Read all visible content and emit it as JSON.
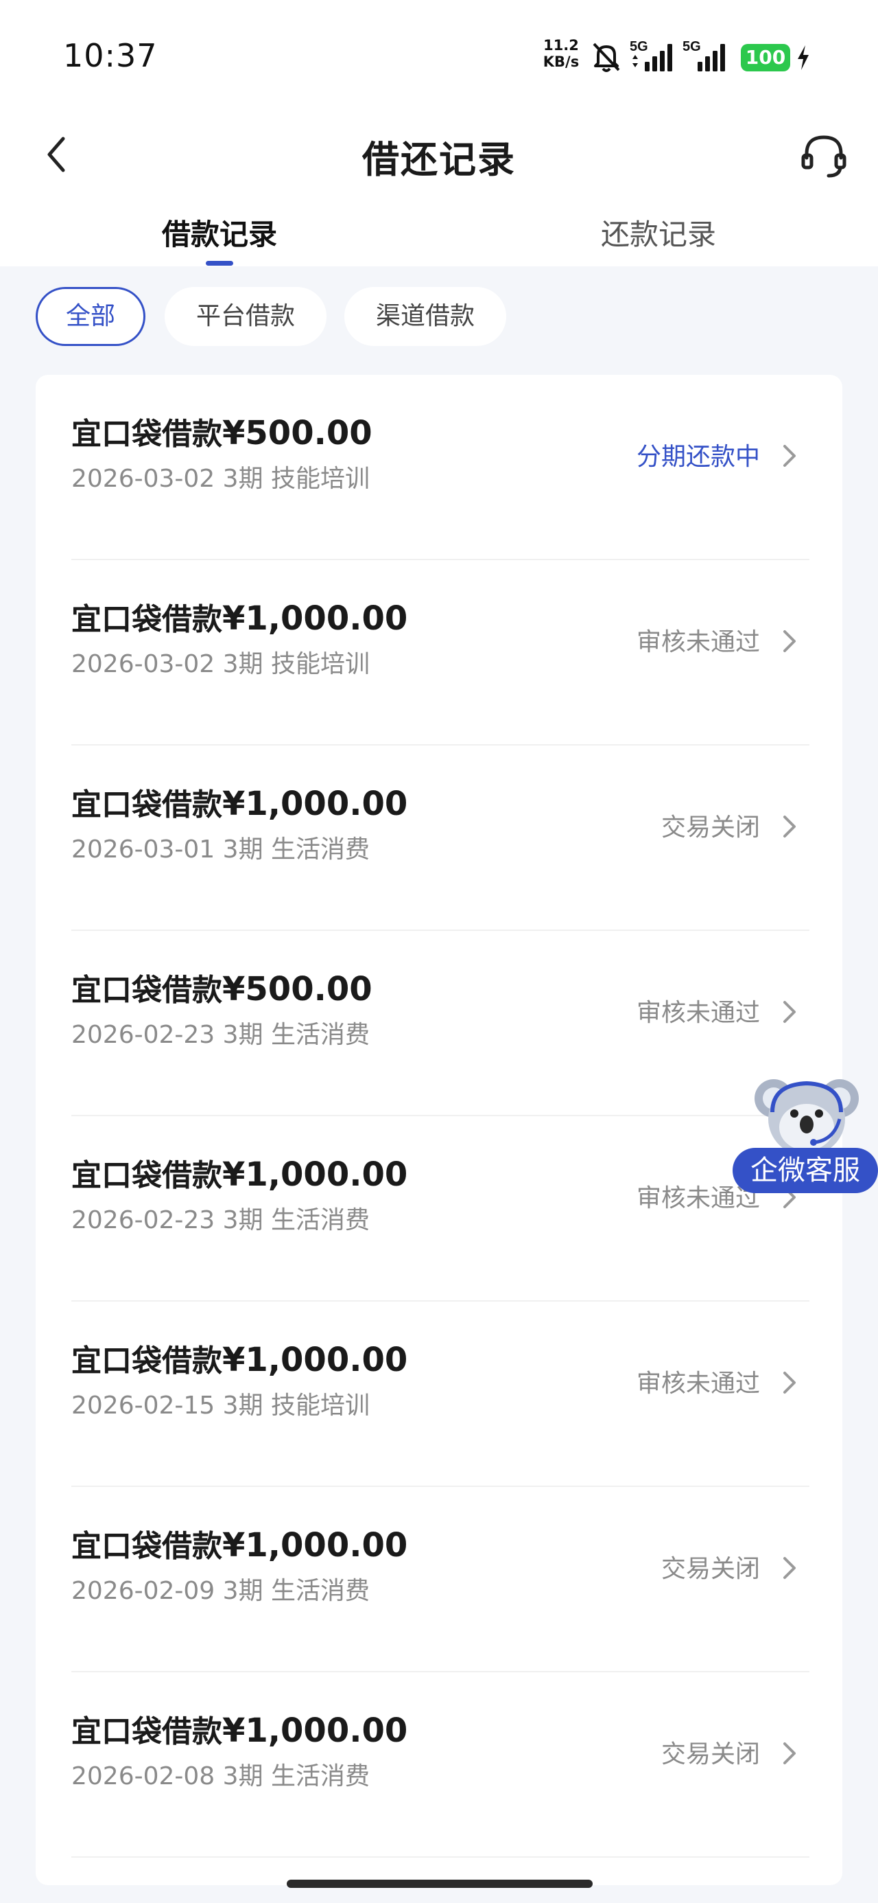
{
  "status_bar": {
    "time": "10:37",
    "net_speed_value": "11.2",
    "net_speed_unit": "KB/s",
    "sim1": "5G",
    "sim2": "5G",
    "battery": "100"
  },
  "header": {
    "title": "借还记录",
    "back_icon": "chevron-left-icon",
    "service_icon": "headset-icon"
  },
  "tabs": [
    {
      "label": "借款记录",
      "active": true
    },
    {
      "label": "还款记录",
      "active": false
    }
  ],
  "filters": [
    {
      "label": "全部",
      "active": true
    },
    {
      "label": "平台借款",
      "active": false
    },
    {
      "label": "渠道借款",
      "active": false
    }
  ],
  "records": [
    {
      "title": "宜口袋借款",
      "amount": "¥500.00",
      "date": "2026-03-02",
      "periods": "3期",
      "purpose": "技能培训",
      "status": "分期还款中",
      "highlight": true
    },
    {
      "title": "宜口袋借款",
      "amount": "¥1,000.00",
      "date": "2026-03-02",
      "periods": "3期",
      "purpose": "技能培训",
      "status": "审核未通过",
      "highlight": false
    },
    {
      "title": "宜口袋借款",
      "amount": "¥1,000.00",
      "date": "2026-03-01",
      "periods": "3期",
      "purpose": "生活消费",
      "status": "交易关闭",
      "highlight": false
    },
    {
      "title": "宜口袋借款",
      "amount": "¥500.00",
      "date": "2026-02-23",
      "periods": "3期",
      "purpose": "生活消费",
      "status": "审核未通过",
      "highlight": false
    },
    {
      "title": "宜口袋借款",
      "amount": "¥1,000.00",
      "date": "2026-02-23",
      "periods": "3期",
      "purpose": "生活消费",
      "status": "审核未通过",
      "highlight": false
    },
    {
      "title": "宜口袋借款",
      "amount": "¥1,000.00",
      "date": "2026-02-15",
      "periods": "3期",
      "purpose": "技能培训",
      "status": "审核未通过",
      "highlight": false
    },
    {
      "title": "宜口袋借款",
      "amount": "¥1,000.00",
      "date": "2026-02-09",
      "periods": "3期",
      "purpose": "生活消费",
      "status": "交易关闭",
      "highlight": false
    },
    {
      "title": "宜口袋借款",
      "amount": "¥1,000.00",
      "date": "2026-02-08",
      "periods": "3期",
      "purpose": "生活消费",
      "status": "交易关闭",
      "highlight": false
    }
  ],
  "floating_service": {
    "label": "企微客服",
    "icon": "koala-mascot-icon"
  },
  "colors": {
    "accent": "#3451c7",
    "background": "#f4f6fa",
    "muted_text": "#8a8a8a"
  }
}
